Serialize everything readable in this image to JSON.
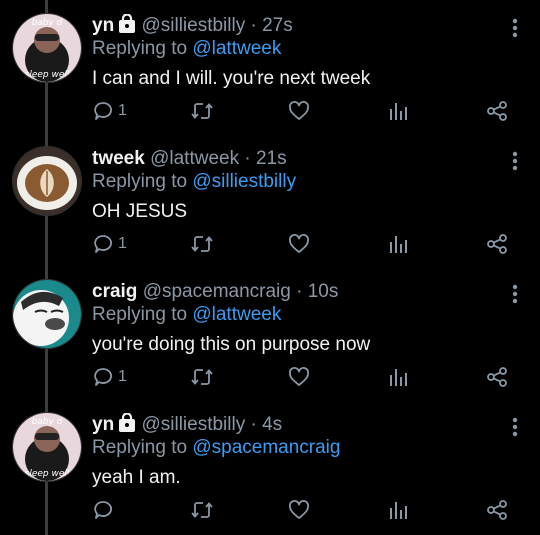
{
  "colors": {
    "background": "#000000",
    "link": "#3d9cf0",
    "muted": "#8b98a5",
    "text": "#f2f2f2"
  },
  "icons": [
    "lock-icon",
    "more-icon",
    "reply-icon",
    "retweet-icon",
    "like-icon",
    "analytics-icon",
    "share-icon"
  ],
  "tweets": [
    {
      "avatar_caption_top": "baby d",
      "avatar_caption_bottom": "sleep well",
      "name": "yn",
      "handle": "@silliestbilly",
      "separator": "·",
      "time": "27s",
      "replying_to": "Replying to",
      "mention": "@lattweek",
      "text": "I can and I will. you're next tweek",
      "reply_count": "1"
    },
    {
      "name": "tweek",
      "handle": "@lattweek",
      "separator": "·",
      "time": "21s",
      "replying_to": "Replying to",
      "mention": "@silliestbilly",
      "text": "OH JESUS",
      "reply_count": "1"
    },
    {
      "name": "craig",
      "handle": "@spacemancraig",
      "separator": "·",
      "time": "10s",
      "replying_to": "Replying to",
      "mention": "@lattweek",
      "text": "you're doing this on purpose now",
      "reply_count": "1"
    },
    {
      "avatar_caption_top": "baby d",
      "avatar_caption_bottom": "sleep well",
      "name": "yn",
      "handle": "@silliestbilly",
      "separator": "·",
      "time": "4s",
      "replying_to": "Replying to",
      "mention": "@spacemancraig",
      "text": "yeah I am.",
      "reply_count": ""
    }
  ]
}
